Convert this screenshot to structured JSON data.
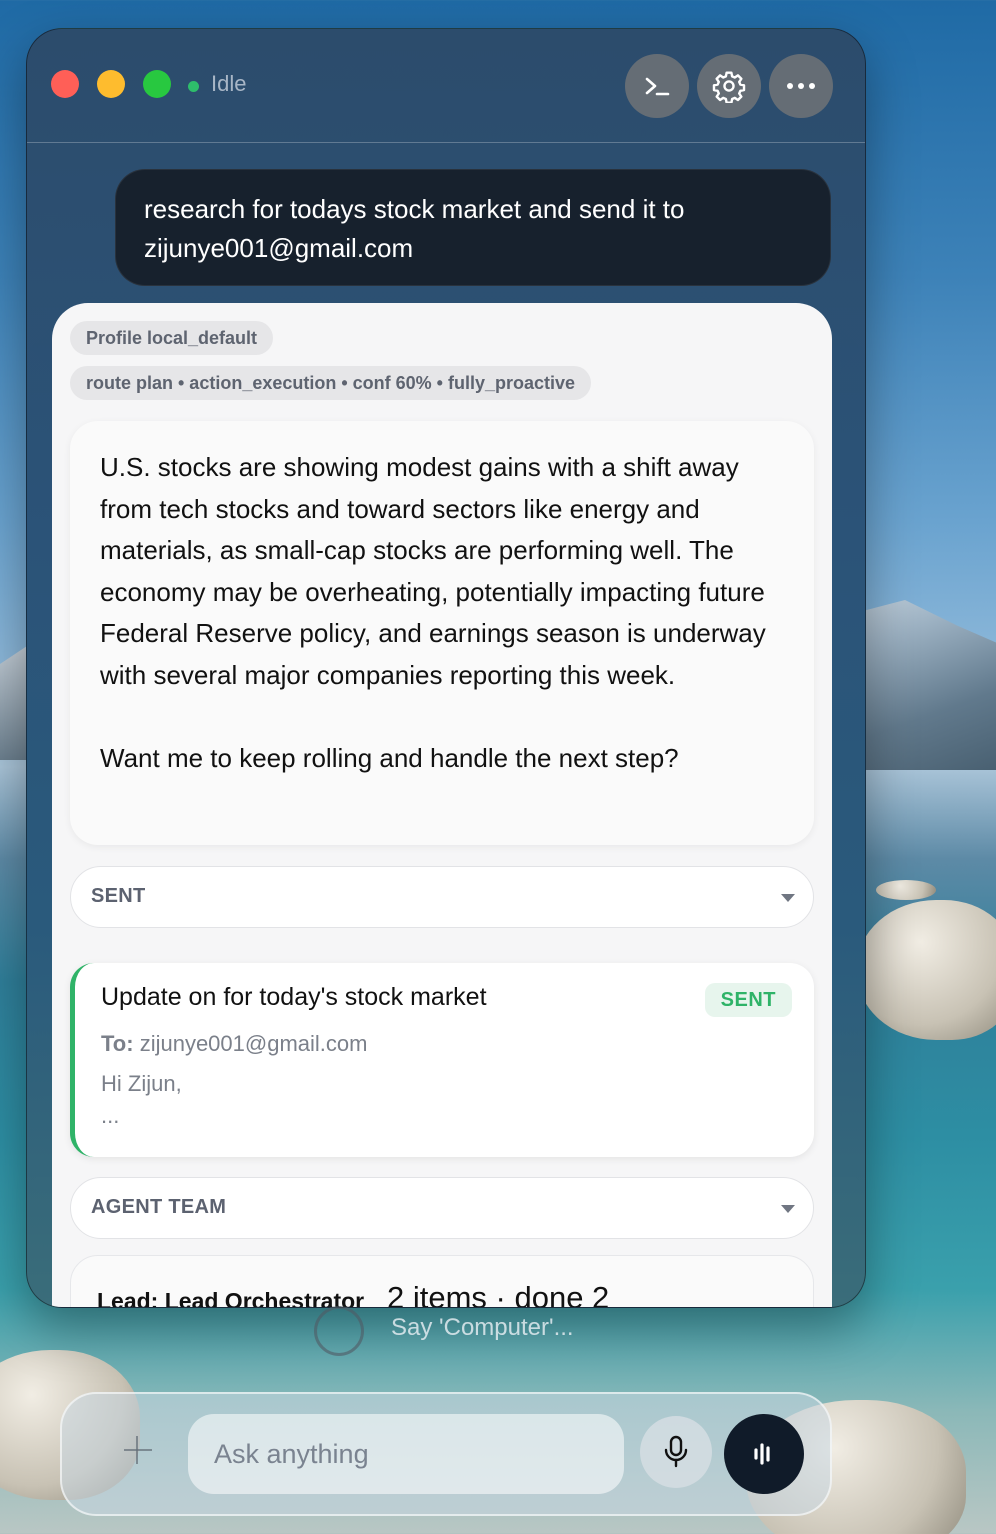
{
  "titlebar": {
    "status": "Idle",
    "status_color": "#2ebd6b",
    "buttons": [
      {
        "icon": "terminal-icon"
      },
      {
        "icon": "gear-icon"
      },
      {
        "icon": "more-icon"
      }
    ]
  },
  "conversation": {
    "user_message": "research for todays stock market and send it to zijunye001@gmail.com",
    "meta_chips": [
      "Profile local_default",
      "route plan • action_execution • conf 60% • fully_proactive"
    ],
    "assistant_paragraphs": [
      "U.S. stocks are showing modest gains with a shift away from tech stocks and toward sectors like energy and materials, as small-cap stocks are performing well. The economy may be overheating, potentially impacting future Federal Reserve policy, and earnings season is underway with several major companies reporting this week.",
      "Want me to keep rolling and handle the next step?"
    ],
    "sections": {
      "sent_label": "SENT",
      "agent_team_label": "AGENT TEAM"
    },
    "email": {
      "subject": "Update on for today's stock market",
      "status": "SENT",
      "status_color": "#2fb368",
      "to_label": "To:",
      "to_address": "zijunye001@gmail.com",
      "greeting": "Hi Zijun,",
      "ellipsis": "..."
    },
    "team": {
      "lead": "Lead: Lead Orchestrator",
      "summary": "2 items · done 2"
    }
  },
  "voice_hint": "Say 'Computer'...",
  "input": {
    "placeholder": "Ask anything",
    "value": ""
  }
}
